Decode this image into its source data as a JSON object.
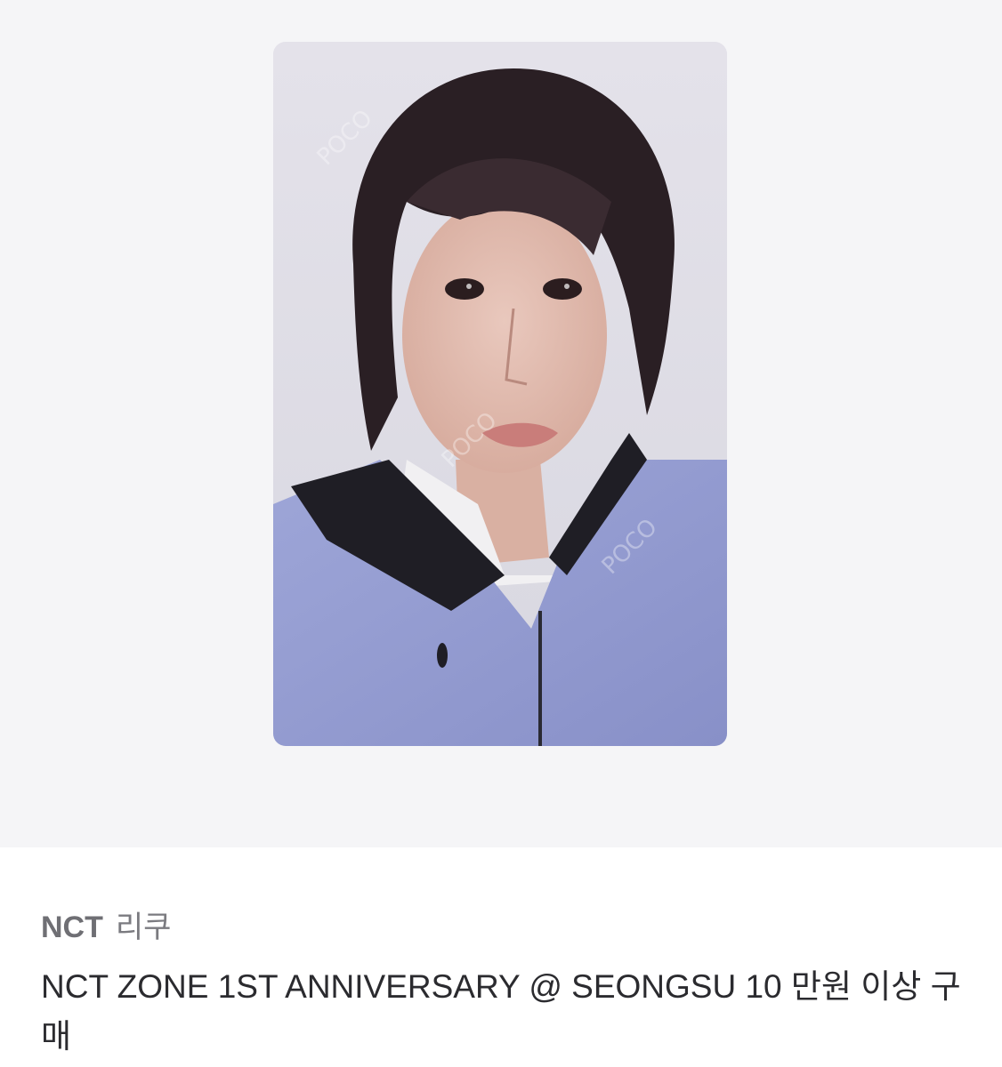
{
  "colors": {
    "hero_background": "#f5f5f7",
    "text_primary": "#2b2b2f",
    "text_secondary": "#7b7b80"
  },
  "product_image": {
    "kind": "photocard",
    "subject": "idol photocard"
  },
  "listing": {
    "group": "NCT",
    "member": "리쿠",
    "title": "NCT ZONE 1ST ANNIVERSARY @ SEONGSU 10 만원 이상 구매"
  }
}
